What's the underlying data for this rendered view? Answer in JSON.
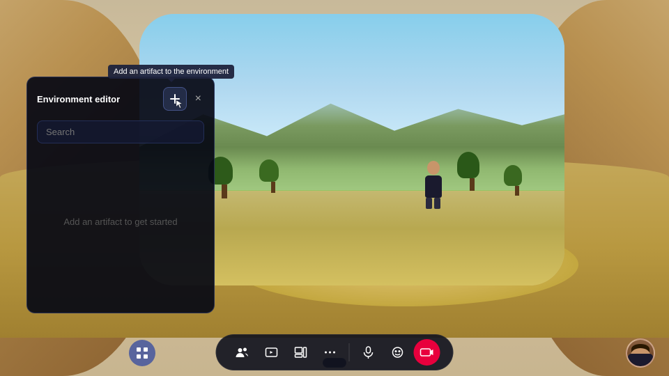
{
  "background": {
    "description": "3D virtual environment with sandy arched room and outdoor landscape view"
  },
  "tooltip": {
    "text": "Add an artifact to the environment"
  },
  "editor_panel": {
    "title": "Environment editor",
    "add_button_label": "+",
    "close_button_label": "×",
    "search_placeholder": "Search",
    "empty_message": "Add an artifact to get started"
  },
  "toolbar": {
    "buttons": [
      {
        "id": "grid",
        "icon": "grid-icon",
        "label": "Apps"
      },
      {
        "id": "people",
        "icon": "people-icon",
        "label": "People"
      },
      {
        "id": "media",
        "icon": "media-icon",
        "label": "Media"
      },
      {
        "id": "share",
        "icon": "share-icon",
        "label": "Share"
      },
      {
        "id": "more",
        "icon": "more-icon",
        "label": "More"
      },
      {
        "id": "mic",
        "icon": "mic-icon",
        "label": "Microphone"
      },
      {
        "id": "emoji",
        "icon": "emoji-icon",
        "label": "Emoji"
      },
      {
        "id": "camera",
        "icon": "camera-icon",
        "label": "Camera",
        "active": true
      }
    ]
  },
  "avatar": {
    "label": "User avatar",
    "position": "bottom-right"
  }
}
